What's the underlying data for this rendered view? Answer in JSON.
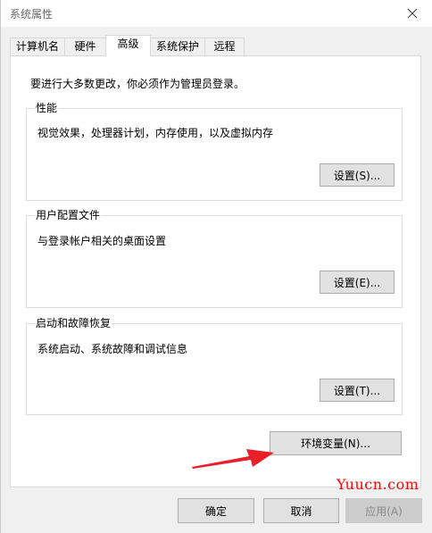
{
  "window": {
    "title": "系统属性"
  },
  "tabs": [
    {
      "label": "计算机名"
    },
    {
      "label": "硬件"
    },
    {
      "label": "高级"
    },
    {
      "label": "系统保护"
    },
    {
      "label": "远程"
    }
  ],
  "active_tab": "高级",
  "advanced": {
    "admin_note": "要进行大多数更改，你必须作为管理员登录。",
    "performance": {
      "title": "性能",
      "description": "视觉效果，处理器计划，内存使用，以及虚拟内存",
      "button": "设置(S)..."
    },
    "user_profiles": {
      "title": "用户配置文件",
      "description": "与登录帐户相关的桌面设置",
      "button": "设置(E)..."
    },
    "startup_recovery": {
      "title": "启动和故障恢复",
      "description": "系统启动、系统故障和调试信息",
      "button": "设置(T)..."
    },
    "env_button": "环境变量(N)..."
  },
  "footer": {
    "ok": "确定",
    "cancel": "取消",
    "apply": "应用(A)"
  },
  "watermark": "Yuucn.com",
  "colors": {
    "arrow": "#e8202a",
    "watermark": "#ff0000"
  }
}
